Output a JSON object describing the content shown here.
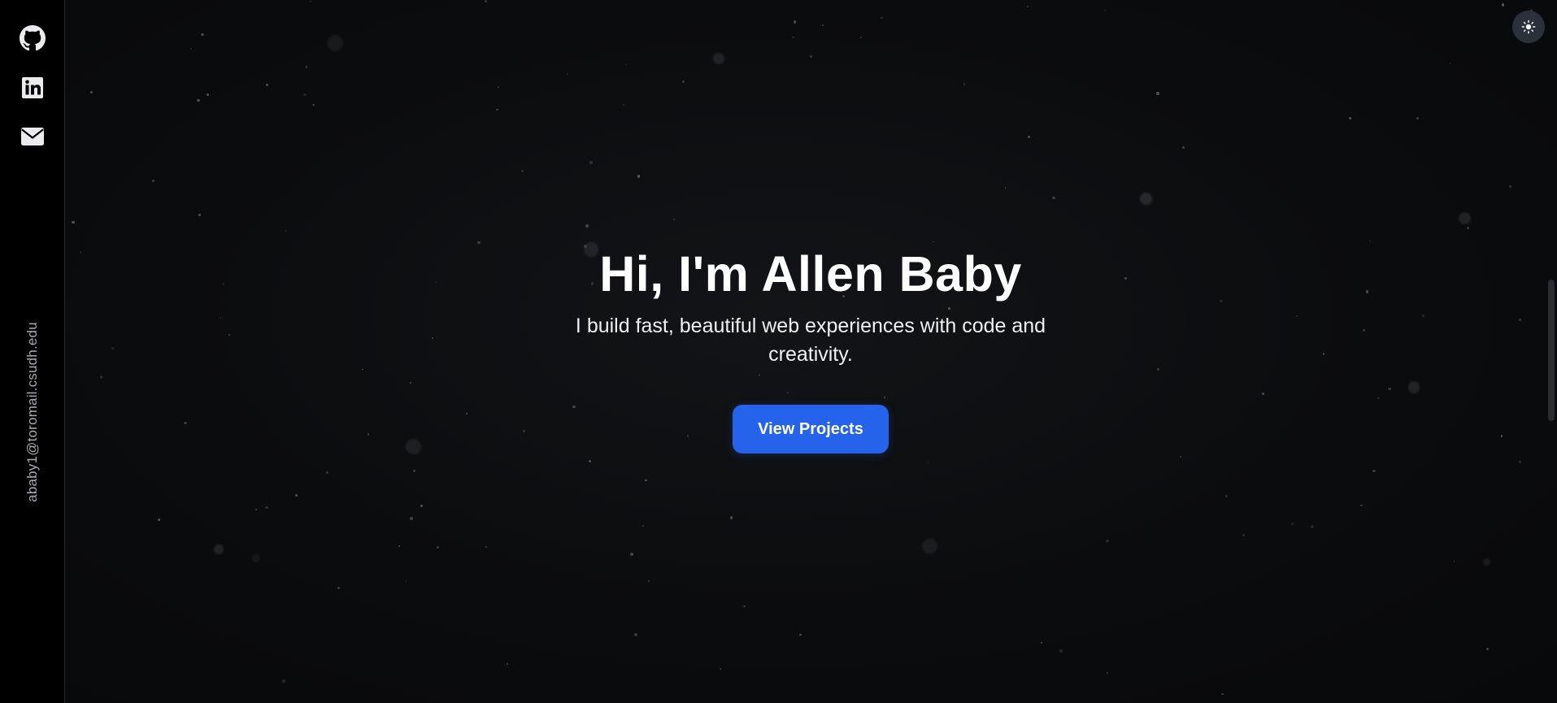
{
  "sidebar": {
    "icons": [
      "github-icon",
      "linkedin-icon",
      "mail-icon"
    ],
    "email": "ababy1@toromail.csudh.edu"
  },
  "hero": {
    "title": "Hi, I'm Allen Baby",
    "subtitle": "I build fast, beautiful web experiences with code and creativity.",
    "cta_label": "View Projects"
  },
  "theme_toggle": {
    "icon": "sun-icon"
  },
  "colors": {
    "background": "#0a0b0d",
    "rail": "#000000",
    "accent": "#2563eb",
    "toggle": "#2b313a",
    "email_text": "#a7abb2"
  }
}
